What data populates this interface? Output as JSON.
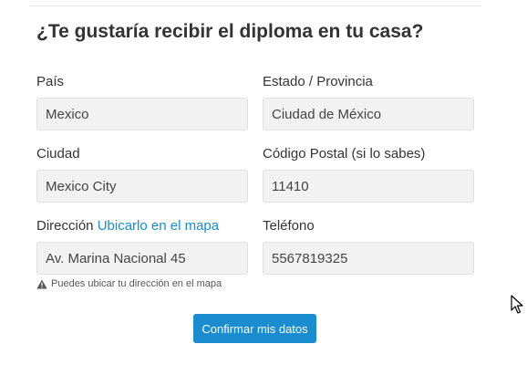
{
  "form": {
    "heading": "¿Te gustaría recibir el diploma en tu casa?",
    "fields": {
      "pais": {
        "label": "País",
        "value": "Mexico"
      },
      "estado": {
        "label": "Estado / Provincia",
        "value": "Ciudad de México"
      },
      "ciudad": {
        "label": "Ciudad",
        "value": "Mexico City"
      },
      "codigo_postal": {
        "label": "Código Postal (si lo sabes)",
        "value": "11410"
      },
      "direccion": {
        "label": "Dirección",
        "link": "Ubicarlo en el mapa",
        "value": "Av. Marina Nacional 45"
      },
      "telefono": {
        "label": "Teléfono",
        "value": "5567819325"
      }
    },
    "hint": "Puedes ubicar tu dirección en el mapa",
    "submit_label": "Confirmar mis datos"
  },
  "colors": {
    "accent": "#1a8ccf",
    "input_bg": "#f2f2f2",
    "text": "#333333"
  },
  "icons": {
    "hint": "warning-icon",
    "pointer": "mouse-cursor-icon"
  }
}
